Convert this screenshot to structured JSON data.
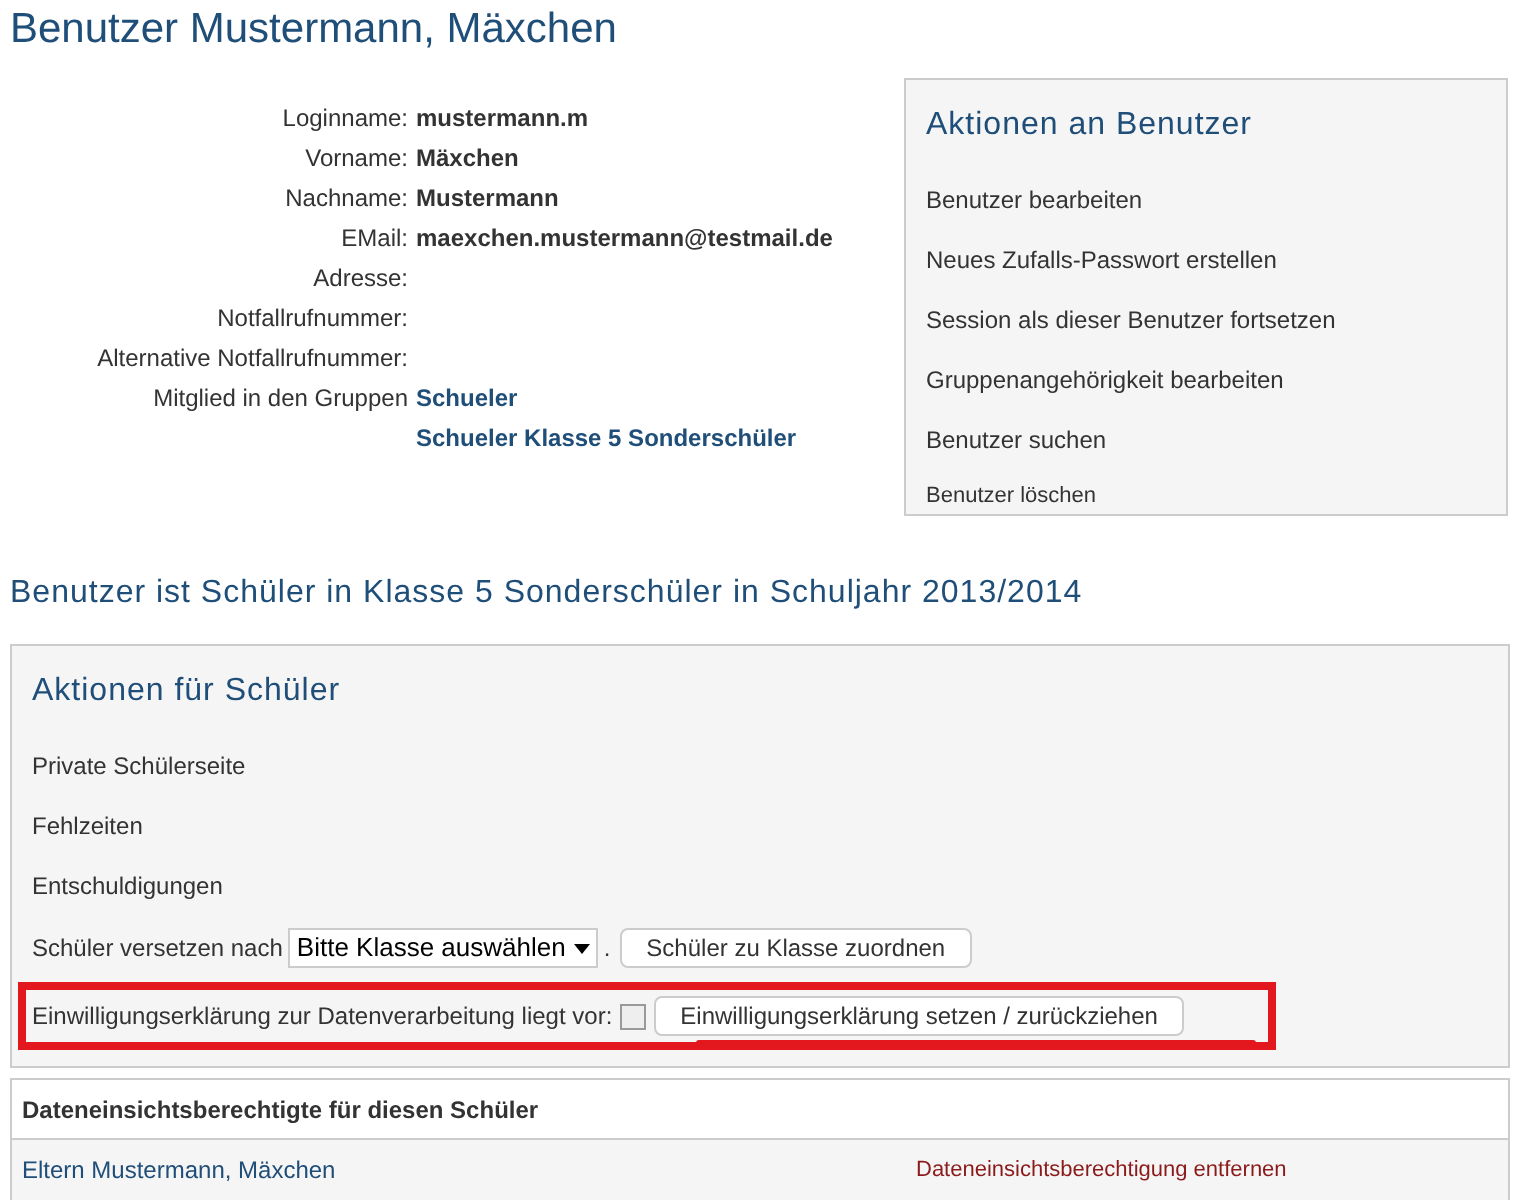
{
  "title": "Benutzer Mustermann, Mäxchen",
  "fields": [
    {
      "label": "Loginname:",
      "values": [
        "mustermann.m"
      ]
    },
    {
      "label": "Vorname:",
      "values": [
        "Mäxchen"
      ]
    },
    {
      "label": "Nachname:",
      "values": [
        "Mustermann"
      ]
    },
    {
      "label": "EMail:",
      "values": [
        "maexchen.mustermann@testmail.de"
      ]
    },
    {
      "label": "Adresse:"
    },
    {
      "label": "Notfallrufnummer:"
    },
    {
      "label": "Alternative Notfallrufnummer:"
    },
    {
      "label": "Mitglied in den Gruppen",
      "links": [
        "Schueler",
        "Schueler Klasse 5 Sonderschüler"
      ]
    }
  ],
  "user_actions": {
    "title": "Aktionen an Benutzer",
    "items": [
      {
        "label": "Benutzer bearbeiten",
        "kind": "normal"
      },
      {
        "label": "Neues Zufalls-Passwort erstellen",
        "kind": "normal"
      },
      {
        "label": "Session als dieser Benutzer fortsetzen",
        "kind": "normal"
      },
      {
        "label": "Gruppenangehörigkeit bearbeiten",
        "kind": "normal"
      },
      {
        "label": "Benutzer suchen",
        "kind": "normal"
      },
      {
        "label": "Benutzer löschen",
        "kind": "small"
      }
    ]
  },
  "section_heading": "Benutzer ist Schüler in Klasse 5 Sonderschüler in Schuljahr 2013/2014",
  "student_actions": {
    "title": "Aktionen für Schüler",
    "links": [
      "Private Schülerseite",
      "Fehlzeiten",
      "Entschuldigungen"
    ],
    "move": {
      "label": "Schüler versetzen nach",
      "select": "Bitte Klasse auswählen",
      "separator": ".",
      "button": "Schüler zu Klasse zuordnen"
    },
    "consent": {
      "label": "Einwilligungserklärung zur Datenverarbeitung liegt vor:",
      "checked": false,
      "button": "Einwilligungserklärung setzen / zurückziehen",
      "highlighted": true
    }
  },
  "access_table": {
    "header": "Dateneinsichtsberechtigte für diesen Schüler",
    "rows": [
      {
        "name": "Eltern Mustermann, Mäxchen",
        "action": "Dateneinsichtsberechtigung entfernen"
      }
    ]
  }
}
